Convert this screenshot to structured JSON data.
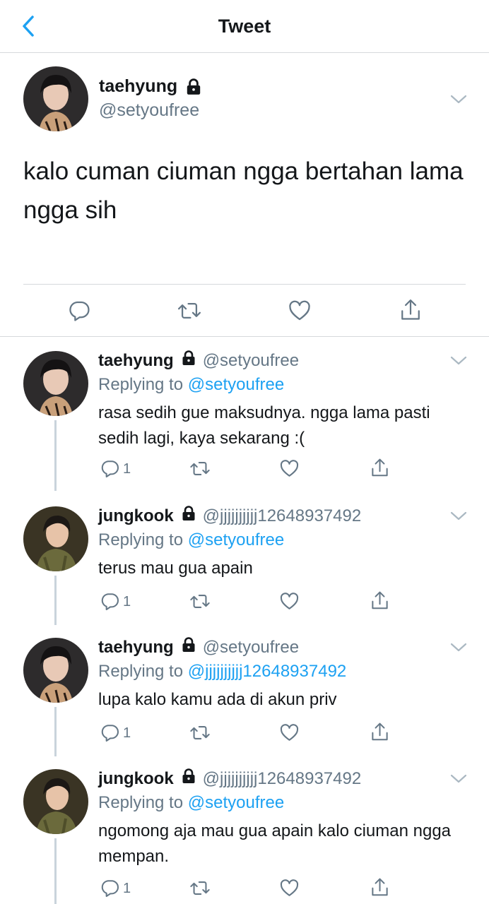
{
  "header": {
    "title": "Tweet"
  },
  "main_tweet": {
    "name": "taehyung",
    "handle": "@setyoufree",
    "text": "kalo cuman ciuman ngga bertahan lama ngga sih"
  },
  "replies": [
    {
      "name": "taehyung",
      "handle": "@setyoufree",
      "replying_label": "Replying to",
      "replying_to": "@setyoufree",
      "text": "rasa sedih gue maksudnya. ngga lama pasti sedih lagi, kaya sekarang :(",
      "reply_count": "1"
    },
    {
      "name": "jungkook",
      "handle": "@jjjjjjjjjj12648937492",
      "replying_label": "Replying to",
      "replying_to": "@setyoufree",
      "text": "terus mau gua apain",
      "reply_count": "1"
    },
    {
      "name": "taehyung",
      "handle": "@setyoufree",
      "replying_label": "Replying to",
      "replying_to": "@jjjjjjjjjj12648937492",
      "text": "lupa kalo kamu ada di akun priv",
      "reply_count": "1"
    },
    {
      "name": "jungkook",
      "handle": "@jjjjjjjjjj12648937492",
      "replying_label": "Replying to",
      "replying_to": "@setyoufree",
      "text": "ngomong aja mau gua apain kalo ciuman ngga mempan.",
      "reply_count": "1"
    }
  ],
  "icons": {
    "back": "chevron-left-icon",
    "lock": "lock-icon",
    "reply": "reply-icon",
    "retweet": "retweet-icon",
    "like": "heart-icon",
    "share": "share-icon",
    "more": "chevron-down-icon"
  },
  "colors": {
    "accent": "#1da1f2",
    "secondary_text": "#657786",
    "icon": "#657786"
  }
}
